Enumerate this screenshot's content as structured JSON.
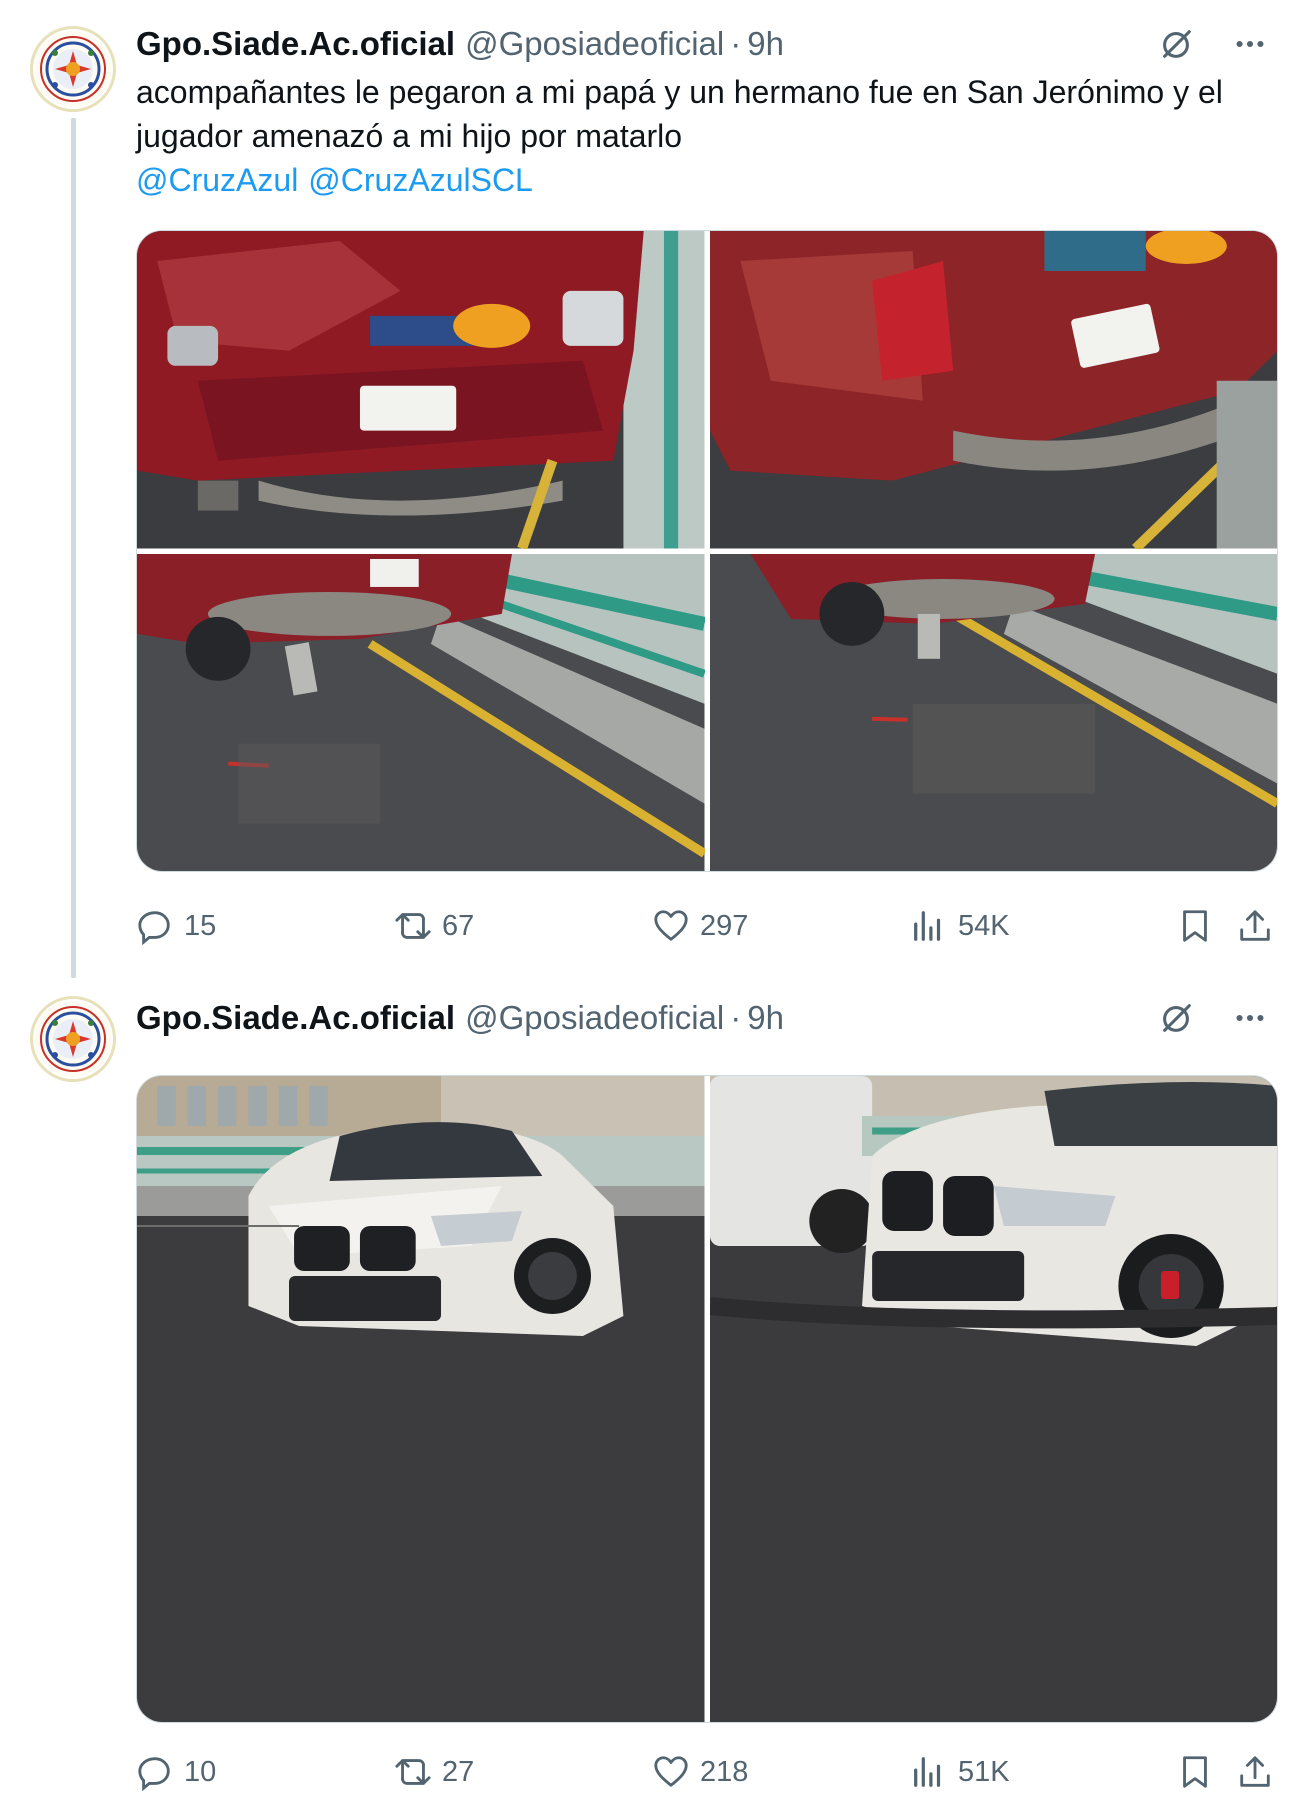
{
  "tweets": [
    {
      "author_name": "Gpo.Siade.Ac.oficial",
      "handle": "@Gposiadeoficial",
      "separator": "·",
      "time": "9h",
      "text": "acompañantes le pegaron a mi papá y un hermano fue en San Jerónimo y el jugador amenazó a mi hijo por matarlo",
      "mentions": [
        "@CruzAzul",
        "@CruzAzulSCL"
      ],
      "photos": [
        "damaged-red-car-rear",
        "damaged-red-car-rear-angle",
        "red-car-on-bridge-lane",
        "red-car-on-bridge-lane-wide"
      ],
      "stats": {
        "replies": "15",
        "reposts": "67",
        "likes": "297",
        "views": "54K"
      }
    },
    {
      "author_name": "Gpo.Siade.Ac.oficial",
      "handle": "@Gposiadeoficial",
      "separator": "·",
      "time": "9h",
      "photos": [
        "white-suv-front-damage",
        "white-suv-front-closeup"
      ],
      "stats": {
        "replies": "10",
        "reposts": "27",
        "likes": "218",
        "views": "51K"
      }
    }
  ],
  "icons": {
    "grok": "grok-icon",
    "more": "more-icon",
    "reply": "reply-icon",
    "repost": "repost-icon",
    "like": "like-icon",
    "views": "views-icon",
    "bookmark": "bookmark-icon",
    "share": "share-icon"
  },
  "colors": {
    "text": "#0f1419",
    "secondary": "#536471",
    "link": "#1d9bf0",
    "border": "#cfd9de"
  }
}
